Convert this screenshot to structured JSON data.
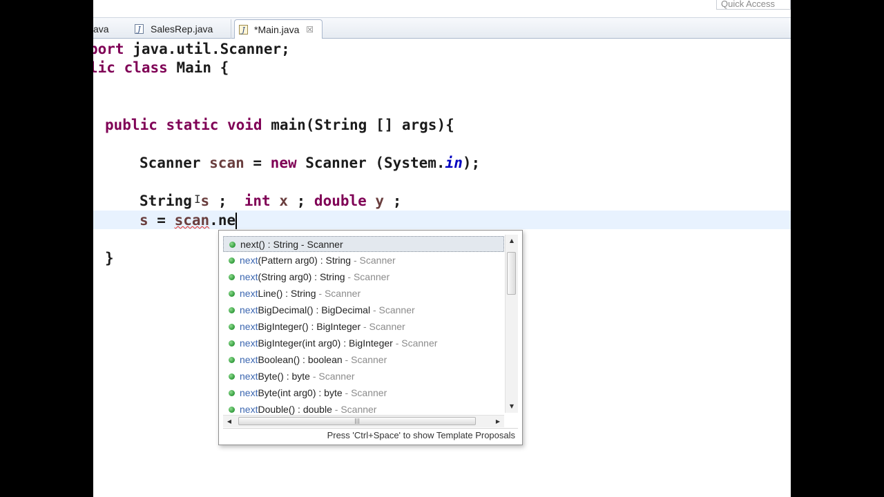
{
  "quick_access": {
    "placeholder": "Quick Access"
  },
  "tabs": [
    {
      "label": "ava",
      "icon": "java-file-icon"
    },
    {
      "label": "SalesRep.java",
      "icon": "java-file-icon"
    },
    {
      "label": "*Main.java",
      "icon": "java-file-icon",
      "active": true,
      "close_icon": "close-icon"
    }
  ],
  "editor": {
    "lines": {
      "import_kw": "port",
      "import_rest": " java.util.Scanner;",
      "class_kw1": "lic",
      "class_kw2": "class",
      "class_name": " Main {",
      "main_kw": "public static void",
      "main_rest": " main(String [] args){",
      "scanner_type": "Scanner ",
      "scanner_var": "scan",
      "scanner_eq": " = ",
      "scanner_new": "new",
      "scanner_call": " Scanner (System.",
      "scanner_in": "in",
      "scanner_end": ");",
      "decl_string": "String ",
      "decl_s": "s",
      "decl_semi1": " ;  ",
      "decl_int": "int",
      "decl_x": " x",
      "decl_semi2": " ; ",
      "decl_double": "double",
      "decl_y": " y",
      "decl_semi3": " ;",
      "assign_s": "s",
      "assign_eq": " = ",
      "assign_scan": "scan",
      "assign_rest": ".ne",
      "close_brace": "}"
    }
  },
  "completion": {
    "proposals": [
      {
        "prefix": "next",
        "signature": "() : String",
        "owner": " - Scanner",
        "selected": true
      },
      {
        "prefix": "next",
        "signature": "(Pattern arg0) : String",
        "owner": " - Scanner"
      },
      {
        "prefix": "next",
        "signature": "(String arg0) : String",
        "owner": " - Scanner"
      },
      {
        "prefix": "next",
        "signature": "Line() : String",
        "owner": " - Scanner"
      },
      {
        "prefix": "next",
        "signature": "BigDecimal() : BigDecimal",
        "owner": " - Scanner"
      },
      {
        "prefix": "next",
        "signature": "BigInteger() : BigInteger",
        "owner": " - Scanner"
      },
      {
        "prefix": "next",
        "signature": "BigInteger(int arg0) : BigInteger",
        "owner": " - Scanner"
      },
      {
        "prefix": "next",
        "signature": "Boolean() : boolean",
        "owner": " - Scanner"
      },
      {
        "prefix": "next",
        "signature": "Byte() : byte",
        "owner": " - Scanner"
      },
      {
        "prefix": "next",
        "signature": "Byte(int arg0) : byte",
        "owner": " - Scanner"
      },
      {
        "prefix": "next",
        "signature": "Double() : double",
        "owner": " - Scanner"
      }
    ],
    "hscroll_thumb_grip": "|||",
    "status": "Press 'Ctrl+Space' to show Template Proposals"
  }
}
